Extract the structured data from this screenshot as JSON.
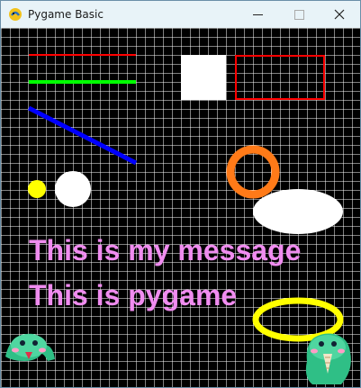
{
  "window": {
    "title": "Pygame Basic"
  },
  "icons": {
    "app": "pygame-snake-icon",
    "minimize": "minimize-icon",
    "maximize": "maximize-icon",
    "close": "close-icon"
  },
  "scene": {
    "background": "#000000",
    "grid_color": "#ffffff",
    "messages": [
      "This is my message",
      "This is pygame"
    ],
    "message_color": "#f08cf0",
    "shapes": {
      "red_line": "#ff0000",
      "green_line": "#00ff00",
      "white_square": "#ffffff",
      "red_rectangle_outline": "#ff0000",
      "blue_line": "#0000ff",
      "orange_ring": "#ff7a18",
      "yellow_dot": "#ffff00",
      "white_circle": "#ffffff",
      "white_ellipse": "#ffffff",
      "yellow_ellipse_outline": "#ffff00"
    },
    "sprites": [
      "snake-sprite-left",
      "snake-sprite-right"
    ]
  }
}
